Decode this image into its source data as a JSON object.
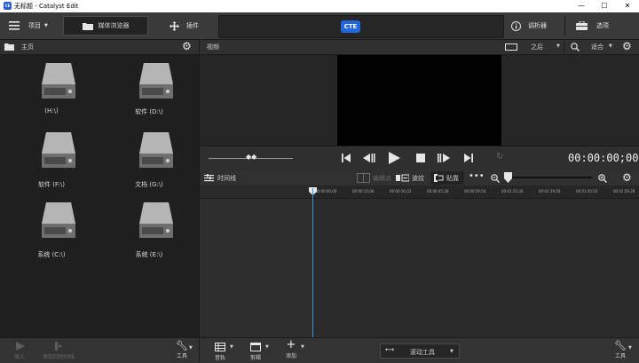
{
  "window": {
    "title": "无标题 - Catalyst Edit",
    "app_badge": "CE",
    "minimize": "—",
    "maximize": "☐",
    "close": "✕"
  },
  "toolbar": {
    "project_label": "项目",
    "media_browser_label": "媒体浏览器",
    "plugins_label": "插件",
    "cte_badge": "CTE",
    "inspector_label": "调析器",
    "options_label": "选项"
  },
  "browser": {
    "header_label": "主页",
    "drives": [
      {
        "label": "(H:\\)"
      },
      {
        "label": "软件 (D:\\)"
      },
      {
        "label": "软件 (F:\\)"
      },
      {
        "label": "文档 (G:\\)"
      },
      {
        "label": "系统 (C:\\)"
      },
      {
        "label": "系统 (E:\\)"
      }
    ]
  },
  "viewer": {
    "header_label": "视频",
    "after_select": "之后",
    "fit_select": "适合",
    "timecode": "00:00:00;00"
  },
  "timeline": {
    "header_label": "时间线",
    "edit_point_label": "编辑点",
    "ripple_label": "波纹",
    "snap_label": "贴靠",
    "ruler_ticks": [
      "00:00:00;00",
      "00:00:15;06",
      "00:00:30;22",
      "00:00:45;28",
      "00:00:59;54",
      "00:01:15;26",
      "00:01:29;58",
      "00:01:45;03",
      "00:01:59;28"
    ]
  },
  "bottom_left": {
    "insert_label": "插入",
    "add_to_timeline_label": "添加到时间线",
    "tools_label": "工具"
  },
  "bottom_right": {
    "tracks_label": "音轨",
    "clip_label": "剪辑",
    "add_label": "添加",
    "scroll_tool_label": "滚动工具",
    "tools_label": "工具"
  },
  "colors": {
    "accent_blue": "#2466e0",
    "playhead": "#3d8fd4"
  }
}
